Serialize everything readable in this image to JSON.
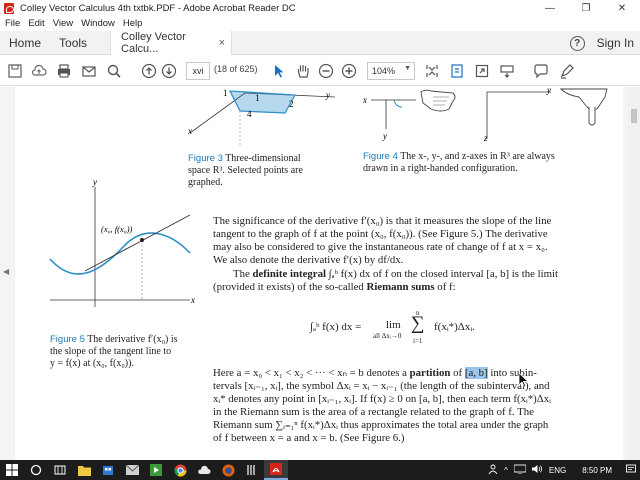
{
  "window": {
    "title": "Colley Vector Calculus 4th txtbk.PDF - Adobe Acrobat Reader DC",
    "minimize": "—",
    "maximize": "❐",
    "close": "✕"
  },
  "menu": [
    "File",
    "Edit",
    "View",
    "Window",
    "Help"
  ],
  "tabs": {
    "home": "Home",
    "tools": "Tools",
    "document": "Colley Vector Calcu...",
    "close": "×",
    "help": "?",
    "sign_in": "Sign In"
  },
  "toolbar": {
    "page_value": "xvi",
    "page_count": "(18 of 625)",
    "zoom": "104%"
  },
  "document": {
    "fig3_labels": [
      "1",
      "1",
      "2",
      "4",
      "y",
      "x"
    ],
    "fig3_caption_label": "Figure 3",
    "fig3_caption_text1": "Three-dimensional",
    "fig3_caption_text2": "space R³. Selected points are",
    "fig3_caption_text3": "graphed.",
    "fig4_labels": [
      "x",
      "y",
      "y",
      "z"
    ],
    "fig4_caption_label": "Figure 4",
    "fig4_caption_text1": "The x-, y-, and z-axes in R³ are always",
    "fig4_caption_text2": "drawn in a right-handed configuration.",
    "fig5_axis_y": "y",
    "fig5_axis_x": "x",
    "fig5_point": "(x₀, f(x₀))",
    "fig5_caption_label": "Figure 5",
    "fig5_caption_text1": "The derivative f′(x₀) is",
    "fig5_caption_text2": "the slope of the tangent line to",
    "fig5_caption_text3": "y = f(x) at (x₀, f(x₀)).",
    "para1": [
      "The significance of the derivative f′(x₀) is that it measures the slope of the line",
      "tangent to the graph of f at the point (x₀, f(x₀)). (See Figure 5.) The derivative",
      "may also be considered to give the instantaneous rate of change of f at x = x₀.",
      "We also denote the derivative f′(x) by df/dx."
    ],
    "para2_a": "The ",
    "para2_bold1": "definite integral",
    "para2_b": " ∫ₐᵇ f(x) dx of f on the closed interval [a, b] is the limit",
    "para2_c": "(provided it exists) of the so-called ",
    "para2_bold2": "Riemann sums",
    "para2_d": " of f:",
    "eq_lhs": "∫ₐᵇ f(x) dx =",
    "eq_lim": "lim",
    "eq_sub": "all Δxᵢ→0",
    "eq_sum": "∑",
    "eq_n": "n",
    "eq_i": "i=1",
    "eq_rhs": "f(xᵢ*)Δxᵢ.",
    "para3_line1_a": "Here a = x₀ < x₁ < x₂ < ··· < xₙ = b denotes a ",
    "para3_bold": "partition",
    "para3_line1_b": " of ",
    "para3_hl": "[a, b]",
    "para3_line1_c": " into subin-",
    "para3_lines": [
      "tervals [xᵢ₋₁, xᵢ], the symbol Δxᵢ = xᵢ − xᵢ₋₁ (the length of the subinterval), and",
      "xᵢ* denotes any point in [xᵢ₋₁, xᵢ]. If f(x) ≥ 0 on [a, b], then each term f(xᵢ*)Δxᵢ",
      "in the Riemann sum is the area of a rectangle related to the graph of f. The",
      "Riemann sum ∑ᵢ₌₁ⁿ f(xᵢ*)Δxᵢ thus approximates the total area under the graph",
      "of f between x = a and x = b. (See Figure 6.)"
    ]
  },
  "taskbar": {
    "lang": "ENG",
    "time": "8:50 PM"
  },
  "colors": {
    "figure_label": "#1a7ab8",
    "fig5_curve": "#2a8ec9",
    "selection": "#9cc4ea",
    "acrobat_red": "#d6241b"
  }
}
